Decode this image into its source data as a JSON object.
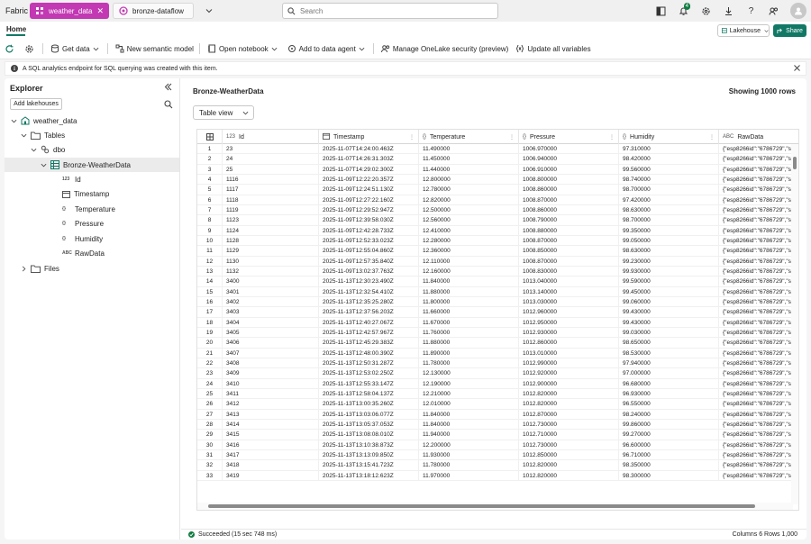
{
  "app": {
    "brand": "Fabric",
    "tabs": [
      {
        "label": "weather_data",
        "active": true
      },
      {
        "label": "bronze-dataflow",
        "active": false
      }
    ],
    "search_placeholder": "Search",
    "notification_count": "4"
  },
  "ribbon": {
    "home_tab": "Home",
    "lakehouse_label": "Lakehouse",
    "share_label": "Share",
    "toolbar": {
      "get_data": "Get data",
      "new_semantic_model": "New semantic model",
      "open_notebook": "Open notebook",
      "add_to_data_agent": "Add to data agent",
      "manage_onelake_security": "Manage OneLake security (preview)",
      "update_all_variables": "Update all variables"
    }
  },
  "infobar": {
    "message": "A SQL analytics endpoint for SQL querying was created with this item."
  },
  "explorer": {
    "title": "Explorer",
    "add_lakehouses": "Add lakehouses",
    "tree": {
      "lakehouse": "weather_data",
      "tables_folder": "Tables",
      "schema": "dbo",
      "table": "Bronze-WeatherData",
      "columns": [
        {
          "type": "123",
          "name": "Id"
        },
        {
          "type": "ts",
          "name": "Timestamp"
        },
        {
          "type": "{}",
          "name": "Temperature"
        },
        {
          "type": "{}",
          "name": "Pressure"
        },
        {
          "type": "{}",
          "name": "Humidity"
        },
        {
          "type": "ABC",
          "name": "RawData"
        }
      ],
      "files_folder": "Files"
    }
  },
  "content": {
    "table_title": "Bronze-WeatherData",
    "showing": "Showing 1000 rows",
    "view": "Table view",
    "columns": [
      {
        "icon": "123",
        "name": "Id"
      },
      {
        "icon": "ts",
        "name": "Timestamp"
      },
      {
        "icon": "{}",
        "name": "Temperature"
      },
      {
        "icon": "{}",
        "name": "Pressure"
      },
      {
        "icon": "{}",
        "name": "Humidity"
      },
      {
        "icon": "ABC",
        "name": "RawData"
      }
    ],
    "rows": [
      [
        "1",
        "23",
        "2025-11-07T14:24:00.463Z",
        "11.490000",
        "1006.970000",
        "97.310000",
        "{\"esp8266id\":\"6786729\",\"so"
      ],
      [
        "2",
        "24",
        "2025-11-07T14:26:31.303Z",
        "11.450000",
        "1006.940000",
        "98.420000",
        "{\"esp8266id\":\"6786729\",\"so"
      ],
      [
        "3",
        "25",
        "2025-11-07T14:29:02.300Z",
        "11.440000",
        "1006.910000",
        "99.560000",
        "{\"esp8266id\":\"6786729\",\"so"
      ],
      [
        "4",
        "1116",
        "2025-11-09T12:22:20.357Z",
        "12.800000",
        "1008.800000",
        "98.740000",
        "{\"esp8266id\":\"6786729\",\"so"
      ],
      [
        "5",
        "1117",
        "2025-11-09T12:24:51.130Z",
        "12.780000",
        "1008.860000",
        "98.700000",
        "{\"esp8266id\":\"6786729\",\"so"
      ],
      [
        "6",
        "1118",
        "2025-11-09T12:27:22.160Z",
        "12.820000",
        "1008.870000",
        "97.420000",
        "{\"esp8266id\":\"6786729\",\"so"
      ],
      [
        "7",
        "1119",
        "2025-11-09T12:29:52.947Z",
        "12.500000",
        "1008.860000",
        "98.630000",
        "{\"esp8266id\":\"6786729\",\"so"
      ],
      [
        "8",
        "1123",
        "2025-11-09T12:39:58.030Z",
        "12.560000",
        "1008.790000",
        "98.700000",
        "{\"esp8266id\":\"6786729\",\"so"
      ],
      [
        "9",
        "1124",
        "2025-11-09T12:42:28.733Z",
        "12.410000",
        "1008.880000",
        "99.350000",
        "{\"esp8266id\":\"6786729\",\"so"
      ],
      [
        "10",
        "1128",
        "2025-11-09T12:52:33.023Z",
        "12.280000",
        "1008.870000",
        "99.050000",
        "{\"esp8266id\":\"6786729\",\"so"
      ],
      [
        "11",
        "1129",
        "2025-11-09T12:55:04.860Z",
        "12.360000",
        "1008.850000",
        "98.630000",
        "{\"esp8266id\":\"6786729\",\"so"
      ],
      [
        "12",
        "1130",
        "2025-11-09T12:57:35.840Z",
        "12.110000",
        "1008.870000",
        "99.230000",
        "{\"esp8266id\":\"6786729\",\"so"
      ],
      [
        "13",
        "1132",
        "2025-11-09T13:02:37.763Z",
        "12.160000",
        "1008.830000",
        "99.930000",
        "{\"esp8266id\":\"6786729\",\"so"
      ],
      [
        "14",
        "3400",
        "2025-11-13T12:30:23.490Z",
        "11.840000",
        "1013.040000",
        "99.590000",
        "{\"esp8266id\":\"6786729\",\"so"
      ],
      [
        "15",
        "3401",
        "2025-11-13T12:32:54.410Z",
        "11.880000",
        "1013.140000",
        "99.450000",
        "{\"esp8266id\":\"6786729\",\"so"
      ],
      [
        "16",
        "3402",
        "2025-11-13T12:35:25.280Z",
        "11.800000",
        "1013.030000",
        "99.060000",
        "{\"esp8266id\":\"6786729\",\"so"
      ],
      [
        "17",
        "3403",
        "2025-11-13T12:37:56.203Z",
        "11.660000",
        "1012.960000",
        "99.430000",
        "{\"esp8266id\":\"6786729\",\"so"
      ],
      [
        "18",
        "3404",
        "2025-11-13T12:40:27.067Z",
        "11.670000",
        "1012.950000",
        "99.430000",
        "{\"esp8266id\":\"6786729\",\"so"
      ],
      [
        "19",
        "3405",
        "2025-11-13T12:42:57.967Z",
        "11.760000",
        "1012.930000",
        "99.030000",
        "{\"esp8266id\":\"6786729\",\"so"
      ],
      [
        "20",
        "3406",
        "2025-11-13T12:45:29.383Z",
        "11.880000",
        "1012.860000",
        "98.650000",
        "{\"esp8266id\":\"6786729\",\"so"
      ],
      [
        "21",
        "3407",
        "2025-11-13T12:48:00.390Z",
        "11.890000",
        "1013.010000",
        "98.530000",
        "{\"esp8266id\":\"6786729\",\"so"
      ],
      [
        "22",
        "3408",
        "2025-11-13T12:50:31.287Z",
        "11.780000",
        "1012.990000",
        "97.940000",
        "{\"esp8266id\":\"6786729\",\"so"
      ],
      [
        "23",
        "3409",
        "2025-11-13T12:53:02.250Z",
        "12.130000",
        "1012.920000",
        "97.000000",
        "{\"esp8266id\":\"6786729\",\"so"
      ],
      [
        "24",
        "3410",
        "2025-11-13T12:55:33.147Z",
        "12.190000",
        "1012.900000",
        "96.680000",
        "{\"esp8266id\":\"6786729\",\"so"
      ],
      [
        "25",
        "3411",
        "2025-11-13T12:58:04.137Z",
        "12.210000",
        "1012.820000",
        "96.930000",
        "{\"esp8266id\":\"6786729\",\"so"
      ],
      [
        "26",
        "3412",
        "2025-11-13T13:00:35.260Z",
        "12.010000",
        "1012.820000",
        "96.550000",
        "{\"esp8266id\":\"6786729\",\"so"
      ],
      [
        "27",
        "3413",
        "2025-11-13T13:03:06.077Z",
        "11.840000",
        "1012.870000",
        "98.240000",
        "{\"esp8266id\":\"6786729\",\"so"
      ],
      [
        "28",
        "3414",
        "2025-11-13T13:05:37.053Z",
        "11.840000",
        "1012.730000",
        "99.860000",
        "{\"esp8266id\":\"6786729\",\"so"
      ],
      [
        "29",
        "3415",
        "2025-11-13T13:08:08.010Z",
        "11.940000",
        "1012.710000",
        "99.270000",
        "{\"esp8266id\":\"6786729\",\"so"
      ],
      [
        "30",
        "3416",
        "2025-11-13T13:10:38.873Z",
        "12.200000",
        "1012.730000",
        "96.600000",
        "{\"esp8266id\":\"6786729\",\"so"
      ],
      [
        "31",
        "3417",
        "2025-11-13T13:13:09.850Z",
        "11.930000",
        "1012.850000",
        "96.710000",
        "{\"esp8266id\":\"6786729\",\"so"
      ],
      [
        "32",
        "3418",
        "2025-11-13T13:15:41.723Z",
        "11.780000",
        "1012.820000",
        "98.350000",
        "{\"esp8266id\":\"6786729\",\"so"
      ],
      [
        "33",
        "3419",
        "2025-11-13T13:18:12.623Z",
        "11.970000",
        "1012.820000",
        "98.300000",
        "{\"esp8266id\":\"6786729\",\"so"
      ]
    ]
  },
  "status": {
    "message": "Succeeded (15 sec 748 ms)",
    "summary": "Columns 6 Rows 1,000"
  },
  "colors": {
    "brand_accent": "#c239b3",
    "primary": "#117865",
    "success": "#107c41"
  }
}
